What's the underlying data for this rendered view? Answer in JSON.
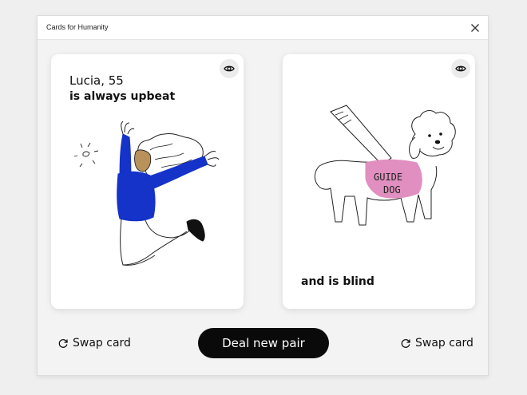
{
  "window": {
    "title": "Cards for Humanity"
  },
  "cards": {
    "left": {
      "name": "Lucia, 55",
      "trait": "is always upbeat"
    },
    "right": {
      "trait": "and is blind",
      "vest_text_line1": "GUIDE",
      "vest_text_line2": "DOG"
    }
  },
  "actions": {
    "swap_left": "Swap card",
    "deal": "Deal new pair",
    "swap_right": "Swap card"
  },
  "icons": {
    "close": "close-icon",
    "eye": "eye-icon",
    "swap": "refresh-icon"
  },
  "colors": {
    "sweater": "#1533c8",
    "skin": "#b8925a",
    "vest": "#e08fc0",
    "button": "#0a0a0a"
  }
}
